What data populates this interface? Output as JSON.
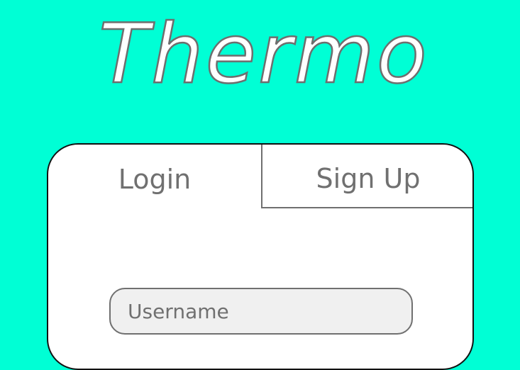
{
  "app": {
    "title": "Thermo"
  },
  "auth": {
    "tabs": [
      {
        "label": "Login"
      },
      {
        "label": "Sign Up"
      }
    ],
    "username": {
      "value": "",
      "placeholder": "Username"
    }
  },
  "colors": {
    "background": "#00FFD5",
    "card": "#FFFFFF",
    "card_border": "#111111",
    "text_gray": "#707070",
    "input_fill": "#F0F0F0"
  }
}
